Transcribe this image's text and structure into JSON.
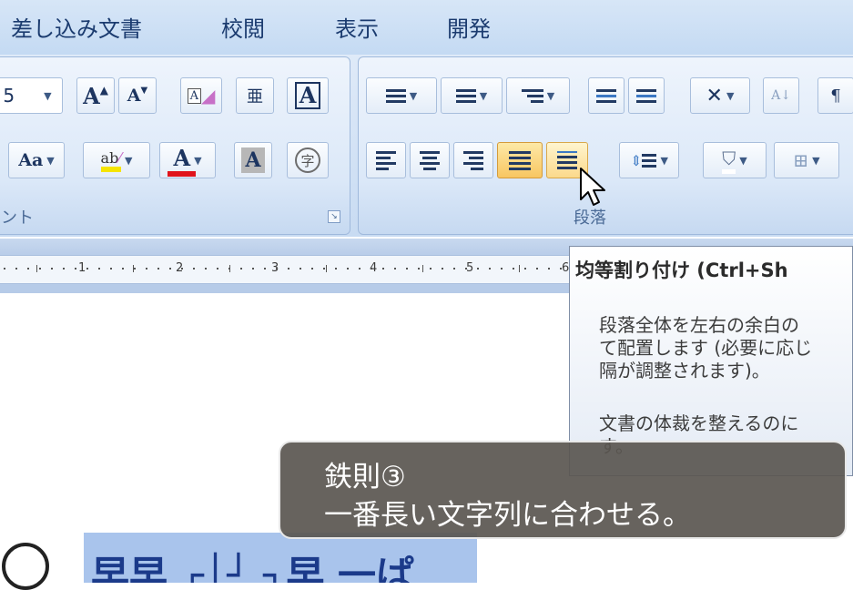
{
  "menu": {
    "tabs": [
      "差し込み文書",
      "校閲",
      "表示",
      "開発"
    ]
  },
  "font_group": {
    "label": "ント",
    "size_value": "5",
    "buttons": {
      "grow_font": "A",
      "shrink_font": "A",
      "clear_format": "A",
      "phonetic": "亜",
      "char_border": "A",
      "change_case": "Aa",
      "highlight": "ab",
      "font_color": "A",
      "char_shading": "A",
      "enclose_char": "字"
    },
    "highlight_color": "#f5e400",
    "font_color_bar": "#e0141b"
  },
  "paragraph_group": {
    "label": "段落",
    "active_button": "justify",
    "hover_button": "distributed"
  },
  "ruler": {
    "numbers": [
      "1",
      "2",
      "3",
      "4",
      "5",
      "6"
    ]
  },
  "tooltip": {
    "title": "均等割り付け (Ctrl+Sh",
    "lines": [
      "段落全体を左右の余白の",
      "て配置します (必要に応じ",
      "隔が調整されます)。",
      "文書の体裁を整えるのに",
      "す。"
    ]
  },
  "caption": {
    "line1": "鉄則③",
    "line2": "一番長い文字列に合わせる。"
  },
  "document": {
    "text": "早早 ┌│┘ ┐早 一ぱ"
  },
  "icons": {
    "cursor": "arrow-cursor-icon",
    "launcher": "dialog-launcher-icon"
  }
}
